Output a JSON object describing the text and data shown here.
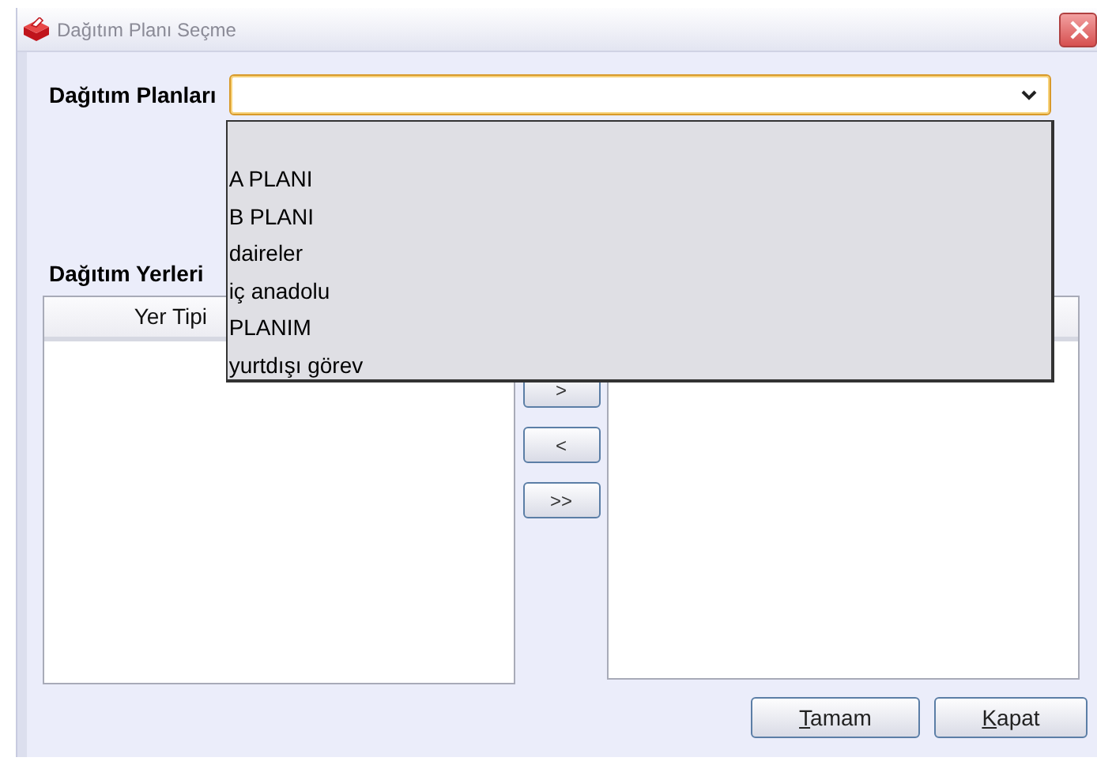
{
  "window": {
    "title": "Dağıtım Planı Seçme"
  },
  "plan_combo": {
    "label": "Dağıtım Planları",
    "expanded": true,
    "options": [
      {
        "label": "A PLANI",
        "selected": false
      },
      {
        "label": "B PLANI",
        "selected": false
      },
      {
        "label": "daireler",
        "selected": false
      },
      {
        "label": "iç anadolu",
        "selected": false
      },
      {
        "label": "PLANIM",
        "selected": false
      },
      {
        "label": "yurtdışı görev",
        "selected": false
      }
    ]
  },
  "places": {
    "label": "Dağıtım Yerleri",
    "left_table": {
      "columns": [
        "Yer Tipi"
      ]
    },
    "move_buttons": [
      ">",
      "<",
      ">>"
    ]
  },
  "buttons": [
    "Tamam",
    "Kapat"
  ]
}
